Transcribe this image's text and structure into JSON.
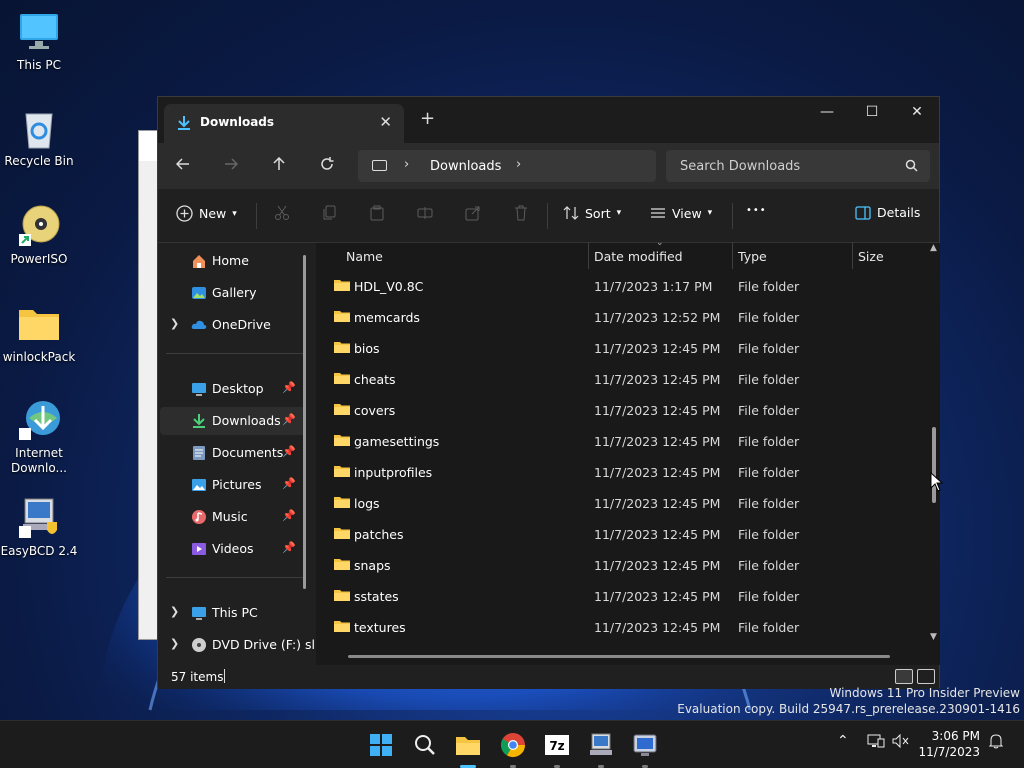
{
  "desktop": {
    "icons": [
      {
        "label": "This PC",
        "icon": "monitor-icon"
      },
      {
        "label": "Recycle Bin",
        "icon": "recycle-bin-icon"
      },
      {
        "label": "PowerISO",
        "icon": "disc-icon"
      },
      {
        "label": "winlockPack",
        "icon": "folder-icon"
      },
      {
        "label": "Internet Downlo...",
        "icon": "globe-download-icon"
      },
      {
        "label": "EasyBCD 2.4",
        "icon": "computer-shield-icon"
      }
    ]
  },
  "tab": {
    "title": "Downloads",
    "close": "✕",
    "new": "+"
  },
  "window_controls": {
    "minimize": "—",
    "maximize": "☐",
    "close": "✕"
  },
  "address": {
    "crumb": "Downloads",
    "search_placeholder": "Search Downloads"
  },
  "commands": {
    "new": "New",
    "sort": "Sort",
    "view": "View",
    "more": "•••",
    "details": "Details"
  },
  "sidebar": {
    "top": [
      {
        "label": "Home",
        "icon": "home-icon"
      },
      {
        "label": "Gallery",
        "icon": "gallery-icon"
      },
      {
        "label": "OneDrive",
        "icon": "cloud-icon"
      }
    ],
    "pinned": [
      {
        "label": "Desktop",
        "icon": "desktop-icon"
      },
      {
        "label": "Downloads",
        "icon": "download-icon"
      },
      {
        "label": "Documents",
        "icon": "document-icon"
      },
      {
        "label": "Pictures",
        "icon": "picture-icon"
      },
      {
        "label": "Music",
        "icon": "music-icon"
      },
      {
        "label": "Videos",
        "icon": "video-icon"
      }
    ],
    "bottom": [
      {
        "label": "This PC",
        "icon": "monitor-icon"
      },
      {
        "label": "DVD Drive (F:) sl",
        "icon": "dvd-icon"
      }
    ]
  },
  "columns": {
    "name": "Name",
    "date": "Date modified",
    "type": "Type",
    "size": "Size"
  },
  "files": [
    {
      "name": "HDL_V0.8C",
      "date": "11/7/2023 1:17 PM",
      "type": "File folder"
    },
    {
      "name": "memcards",
      "date": "11/7/2023 12:52 PM",
      "type": "File folder"
    },
    {
      "name": "bios",
      "date": "11/7/2023 12:45 PM",
      "type": "File folder"
    },
    {
      "name": "cheats",
      "date": "11/7/2023 12:45 PM",
      "type": "File folder"
    },
    {
      "name": "covers",
      "date": "11/7/2023 12:45 PM",
      "type": "File folder"
    },
    {
      "name": "gamesettings",
      "date": "11/7/2023 12:45 PM",
      "type": "File folder"
    },
    {
      "name": "inputprofiles",
      "date": "11/7/2023 12:45 PM",
      "type": "File folder"
    },
    {
      "name": "logs",
      "date": "11/7/2023 12:45 PM",
      "type": "File folder"
    },
    {
      "name": "patches",
      "date": "11/7/2023 12:45 PM",
      "type": "File folder"
    },
    {
      "name": "snaps",
      "date": "11/7/2023 12:45 PM",
      "type": "File folder"
    },
    {
      "name": "sstates",
      "date": "11/7/2023 12:45 PM",
      "type": "File folder"
    },
    {
      "name": "textures",
      "date": "11/7/2023 12:45 PM",
      "type": "File folder"
    }
  ],
  "status": {
    "count": "57 items"
  },
  "watermark": {
    "line1": "Windows 11 Pro Insider Preview",
    "line2": "Evaluation copy. Build 25947.rs_prerelease.230901-1416"
  },
  "clock": {
    "time": "3:06 PM",
    "date": "11/7/2023"
  },
  "taskbar_icons": [
    "start-icon",
    "search-icon",
    "file-explorer-icon",
    "chrome-icon",
    "7zip-icon",
    "computer-app-icon",
    "remote-app-icon"
  ],
  "colors": {
    "accent": "#4cc2ff",
    "folder": "#f5c542",
    "window_bg": "#202020"
  }
}
